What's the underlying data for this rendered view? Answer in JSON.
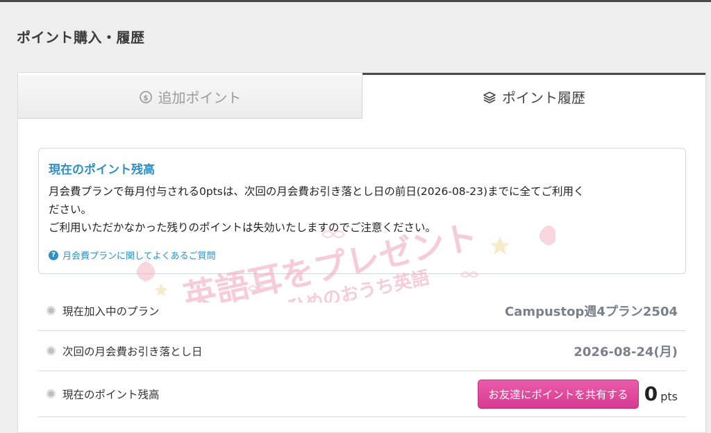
{
  "page": {
    "title": "ポイント購入・履歴"
  },
  "tabs": [
    {
      "label": "追加ポイント",
      "icon": "dollar-circle-icon",
      "active": false
    },
    {
      "label": "ポイント履歴",
      "icon": "layers-icon",
      "active": true
    }
  ],
  "info": {
    "title": "現在のポイント残高",
    "line1": "月会費プランで毎月付与される0ptsは、次回の月会費お引き落とし日の前日(2026-08-23)までに全てご利用く",
    "line2": "ださい。",
    "line3": "ご利用いただかなかった残りのポイントは失効いたしますのでご注意ください。",
    "help_link": "月会費プランに関してよくあるご質問"
  },
  "watermark": {
    "main": "英語耳をプレゼント",
    "sub": "ひめのおうち英語",
    "colors": {
      "pink": "#f6b9c9",
      "gold": "#f3dfa8"
    }
  },
  "rows": [
    {
      "label": "現在加入中のプラン",
      "value": "Campustop週4プラン2504"
    },
    {
      "label": "次回の月会費お引き落とし日",
      "value": "2026-08-24(月)"
    },
    {
      "label": "現在のポイント残高",
      "button": "お友達にポイントを共有する",
      "points": "0",
      "unit": "pts"
    }
  ],
  "colors": {
    "accent": "#2f8fc0",
    "share_button": "#e0479d",
    "tab_border": "#4a4a4a"
  }
}
